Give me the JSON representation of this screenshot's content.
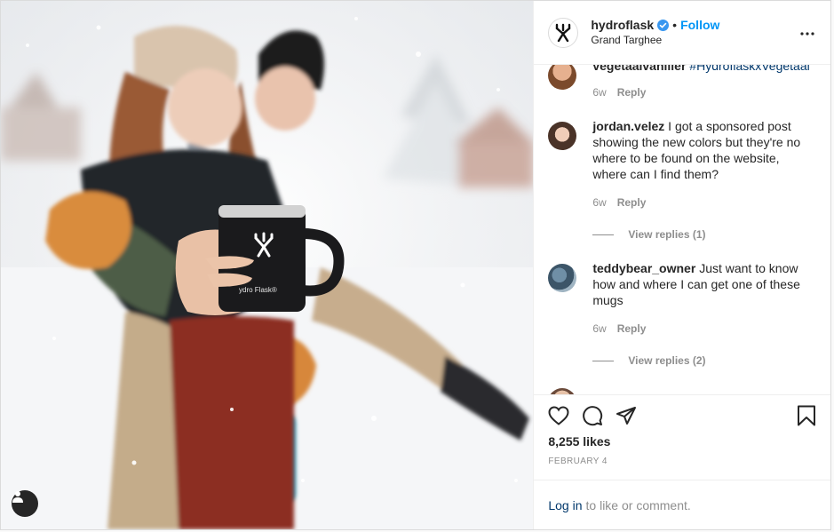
{
  "post": {
    "author": {
      "username": "hydroflask",
      "verified": true,
      "follow_label": "Follow",
      "location": "Grand Targhee",
      "avatar_icon": "hydroflask-logo-icon"
    },
    "photo": {
      "mug_brand_text": "ydro Flask®"
    },
    "comments": [
      {
        "username": "vegetaalvanilier",
        "text": "",
        "tag": "#HydroflaskxVegetaal",
        "age": "6w",
        "reply_label": "Reply",
        "view_replies": ""
      },
      {
        "username": "jordan.velez",
        "text": "I got a sponsored post showing the new colors but they're no where to be found on the website, where can I find them?",
        "tag": "",
        "age": "6w",
        "reply_label": "Reply",
        "view_replies": "View replies (1)"
      },
      {
        "username": "teddybear_owner",
        "text": "Just want to know how and where I can get one of these mugs",
        "tag": "",
        "age": "6w",
        "reply_label": "Reply",
        "view_replies": "View replies (2)"
      }
    ],
    "likes": "8,255 likes",
    "date": "FEBRUARY 4",
    "login": {
      "link": "Log in",
      "rest": "to like or comment."
    }
  },
  "colors": {
    "link_blue": "#0095f6",
    "hashtag_blue": "#00376b",
    "muted": "#8e8e8e"
  }
}
